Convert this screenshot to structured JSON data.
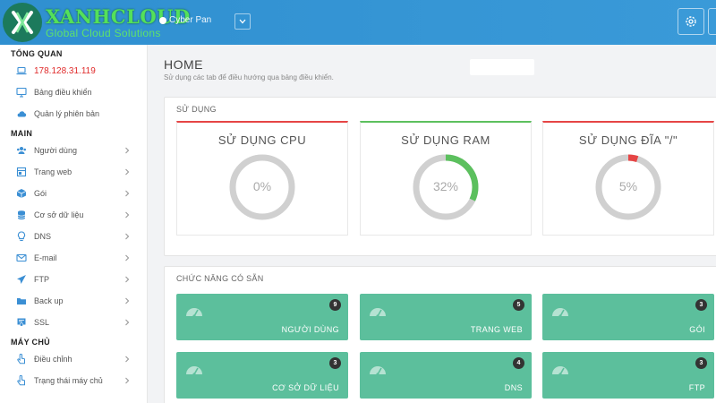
{
  "header": {
    "brand_name": "XANHCLOUD",
    "brand_tagline": "Global Cloud Solutions",
    "user_name": "Cyber Pan"
  },
  "sidebar": {
    "sections": [
      {
        "title": "TỔNG QUAN",
        "items": [
          {
            "label": "178.128.31.119",
            "icon": "laptop-icon",
            "arrow": false
          },
          {
            "label": "Bảng điều khiển",
            "icon": "monitor-icon",
            "arrow": false
          },
          {
            "label": "Quản lý phiên bản",
            "icon": "cloud-icon",
            "arrow": false
          }
        ]
      },
      {
        "title": "MAIN",
        "items": [
          {
            "label": "Người dùng",
            "icon": "users-icon",
            "arrow": true
          },
          {
            "label": "Trang web",
            "icon": "globe-icon",
            "arrow": true
          },
          {
            "label": "Gói",
            "icon": "box-icon",
            "arrow": true
          },
          {
            "label": "Cơ sở dữ liệu",
            "icon": "database-icon",
            "arrow": true
          },
          {
            "label": "DNS",
            "icon": "lightbulb-icon",
            "arrow": true
          },
          {
            "label": "E-mail",
            "icon": "envelope-icon",
            "arrow": true
          },
          {
            "label": "FTP",
            "icon": "paper-plane-icon",
            "arrow": true
          },
          {
            "label": "Back up",
            "icon": "folder-icon",
            "arrow": true
          },
          {
            "label": "SSL",
            "icon": "certificate-icon",
            "arrow": true
          }
        ]
      },
      {
        "title": "MÁY CHỦ",
        "items": [
          {
            "label": "Điều chỉnh",
            "icon": "hand-pointer-icon",
            "arrow": true
          },
          {
            "label": "Trạng thái máy chủ",
            "icon": "hand-pointer-icon",
            "arrow": true
          }
        ]
      }
    ]
  },
  "main": {
    "title": "HOME",
    "subtitle": "Sử dụng các tab để điều hướng qua bảng điều khiển.",
    "usage_panel_title": "SỬ DỤNG",
    "gauges": [
      {
        "title": "SỬ DỤNG CPU",
        "value_text": "0%",
        "percent": 0,
        "top_color": "#e64545",
        "ring_color": "#e64545"
      },
      {
        "title": "SỬ DỤNG RAM",
        "value_text": "32%",
        "percent": 32,
        "top_color": "#5cc05e",
        "ring_color": "#5cc05e"
      },
      {
        "title": "SỬ DỤNG ĐĨA \"/\"",
        "value_text": "5%",
        "percent": 5,
        "top_color": "#e64545",
        "ring_color": "#e64545"
      }
    ],
    "features_panel_title": "CHỨC NĂNG CÓ SẴN",
    "tiles": [
      {
        "label": "NGƯỜI DÙNG",
        "count": "9"
      },
      {
        "label": "TRANG WEB",
        "count": "5"
      },
      {
        "label": "GÓI",
        "count": "3"
      },
      {
        "label": "CƠ SỞ DỮ LIỆU",
        "count": "3"
      },
      {
        "label": "DNS",
        "count": "4"
      },
      {
        "label": "FTP",
        "count": "3"
      }
    ]
  },
  "colors": {
    "header_bg": "#3a9ad8",
    "tile_bg": "#5cbf9c",
    "ip_text": "#e02b2b",
    "ring_track": "#d0d0d0"
  }
}
